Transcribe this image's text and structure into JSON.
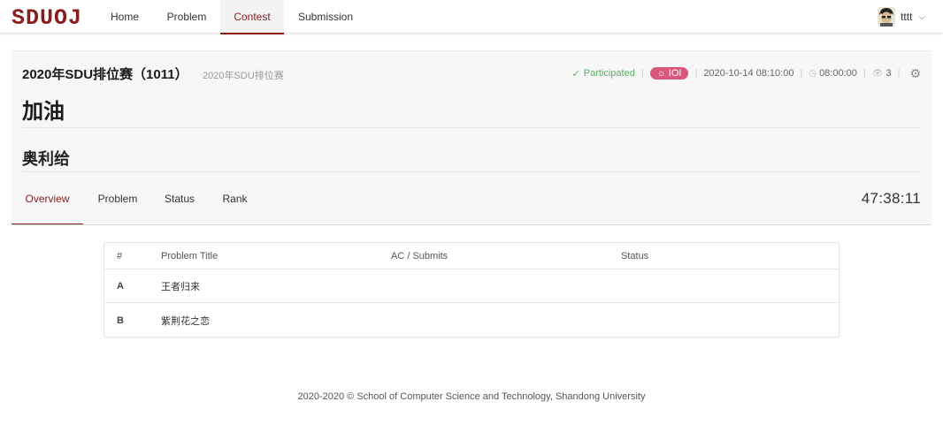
{
  "nav": {
    "logo_text": "SDUOJ",
    "items": [
      {
        "label": "Home"
      },
      {
        "label": "Problem"
      },
      {
        "label": "Contest"
      },
      {
        "label": "Submission"
      }
    ],
    "active": "Contest",
    "username": "tttt"
  },
  "contest": {
    "title": "2020年SDU排位赛（1011）",
    "subtitle": "2020年SDU排位赛",
    "participated": "Participated",
    "mode": "IOI",
    "start_time": "2020-10-14 08:10:00",
    "duration": "08:00:00",
    "participants": "3",
    "heading": "加油",
    "subheading": "奥利给"
  },
  "tabs": [
    {
      "label": "Overview"
    },
    {
      "label": "Problem"
    },
    {
      "label": "Status"
    },
    {
      "label": "Rank"
    }
  ],
  "active_tab": "Overview",
  "countdown": "47:38:11",
  "table": {
    "headers": [
      "#",
      "Problem Title",
      "AC / Submits",
      "Status"
    ],
    "rows": [
      {
        "id": "A",
        "title": "王者归来",
        "ac": "",
        "status": ""
      },
      {
        "id": "B",
        "title": "紫荆花之恋",
        "ac": "",
        "status": ""
      }
    ]
  },
  "footer": "2020-2020 © School of Computer Science and Technology, Shandong University",
  "colors": {
    "accent": "#8a1c1c",
    "participated": "#5bad63",
    "ioi_badge": "#d9577b"
  },
  "icons": {
    "participated": "check-icon",
    "mode": "bulb-icon",
    "duration": "clock-icon",
    "participants": "eye-icon",
    "settings": "gear-icon",
    "user_menu": "chevron-down-icon"
  }
}
